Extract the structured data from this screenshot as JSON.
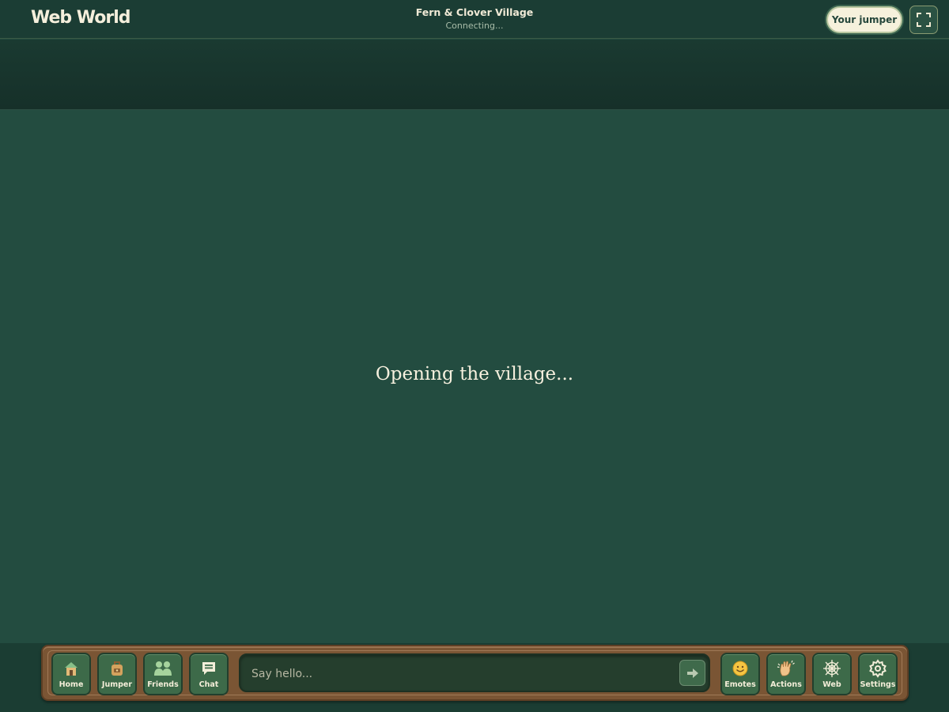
{
  "header": {
    "logo": "Web World",
    "village_name": "Fern & Clover Village",
    "status": "Connecting...",
    "jumper_button": "Your jumper",
    "fullscreen_icon": "fullscreen-icon"
  },
  "main": {
    "loading_text": "Opening the village..."
  },
  "toolbar": {
    "left_tools": [
      {
        "label": "Home",
        "icon": "house-icon"
      },
      {
        "label": "Jumper",
        "icon": "backpack-icon"
      },
      {
        "label": "Friends",
        "icon": "friends-icon"
      },
      {
        "label": "Chat",
        "icon": "chat-icon"
      }
    ],
    "chat": {
      "placeholder": "Say hello...",
      "send_icon": "arrow-right-icon"
    },
    "right_tools": [
      {
        "label": "Emotes",
        "icon": "smiley-icon"
      },
      {
        "label": "Actions",
        "icon": "wave-hand-icon"
      },
      {
        "label": "Web",
        "icon": "spider-web-icon"
      },
      {
        "label": "Settings",
        "icon": "gear-icon"
      }
    ]
  },
  "colors": {
    "background": "#234c40",
    "header": "#1b3d34",
    "toolbar_wood": "#7a5534",
    "button_green": "#3d6a49",
    "cream": "#f6f1dc"
  }
}
